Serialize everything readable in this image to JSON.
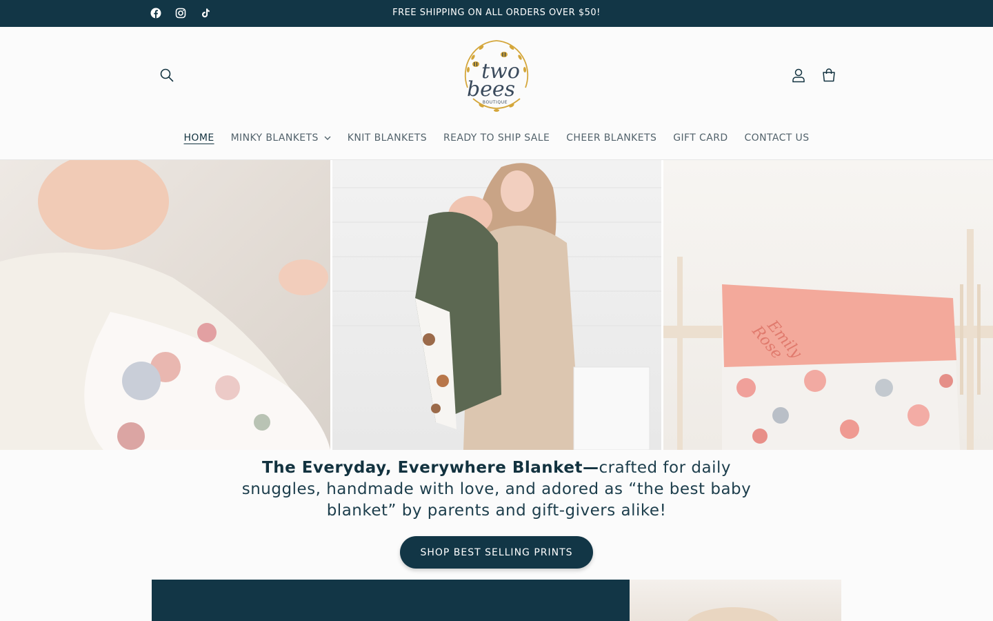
{
  "announcement": {
    "text": "FREE SHIPPING ON ALL ORDERS OVER $50!",
    "social_icons": [
      "facebook-icon",
      "instagram-icon",
      "tiktok-icon"
    ]
  },
  "header": {
    "logo": {
      "line1": "two",
      "line2": "bees",
      "line3": "BOUTIQUE"
    },
    "icons": [
      "search-icon",
      "account-icon",
      "cart-icon"
    ]
  },
  "nav": {
    "items": [
      {
        "label": "HOME",
        "active": true
      },
      {
        "label": "MINKY BLANKETS",
        "dropdown": true
      },
      {
        "label": "KNIT BLANKETS"
      },
      {
        "label": "READY TO SHIP SALE"
      },
      {
        "label": "CHEER BLANKETS"
      },
      {
        "label": "GIFT CARD"
      },
      {
        "label": "CONTACT US"
      }
    ]
  },
  "hero": {
    "panel3_name_line1": "Emily",
    "panel3_name_line2": "Rose"
  },
  "tagline": {
    "bold": "The Everyday, Everywhere Blanket—",
    "rest": "crafted for daily snuggles, handmade with love, and adored as “the best baby blanket” by parents and gift-givers alike!"
  },
  "cta": {
    "label": "SHOP BEST SELLING PRINTS"
  },
  "colors": {
    "brand_dark": "#123646",
    "logo_gold": "#d4a63a",
    "minky_pink": "#f3a99b"
  }
}
